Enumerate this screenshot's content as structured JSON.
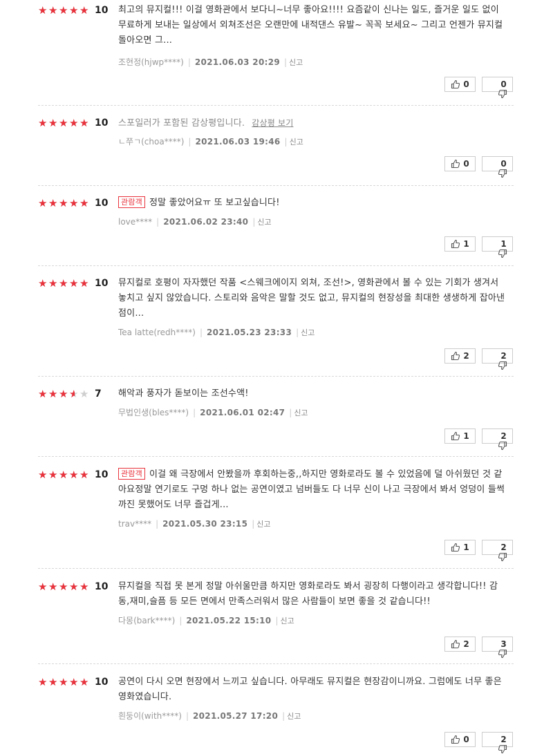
{
  "reviews": [
    {
      "stars": 5,
      "score": "10",
      "badge": "",
      "spoiler": false,
      "text": "최고의 뮤지컬!!! 이걸 영화관에서 보다니~너무 좋아요!!!! 요즘같이 신나는 일도, 즐거운 일도 없이 무료하게 보내는 일상에서 외쳐조선은 오랜만에 내적댄스 유발~ 꼭꼭 보세요~ 그리고 언젠가 뮤지컬 돌아오면 그...",
      "author": "조현정(hjwp****)",
      "date": "2021.06.03 20:29",
      "report": "신고",
      "up": "0",
      "down": "0"
    },
    {
      "stars": 5,
      "score": "10",
      "badge": "",
      "spoiler": true,
      "text": "스포일러가 포함된 감상평입니다.",
      "spoiler_link": "감상평 보기",
      "author": "ㄴ쭈ㄱ(choa****)",
      "date": "2021.06.03 19:46",
      "report": "신고",
      "up": "0",
      "down": "0"
    },
    {
      "stars": 5,
      "score": "10",
      "badge": "관람객",
      "spoiler": false,
      "text": "정말 좋았어요ㅠ 또 보고싶습니다!",
      "author": "love****",
      "date": "2021.06.02 23:40",
      "report": "신고",
      "up": "1",
      "down": "1"
    },
    {
      "stars": 5,
      "score": "10",
      "badge": "",
      "spoiler": false,
      "text": "뮤지컬로 호평이 자자했던 작품 <스웨크에이지 외쳐, 조선!>, 영화관에서 볼 수 있는 기회가 생겨서 놓치고 싶지 않았습니다. 스토리와 음악은 말할 것도 없고, 뮤지컬의 현장성을 최대한 생생하게 잡아낸 점이...",
      "author": "Tea latte(redh****)",
      "date": "2021.05.23 23:33",
      "report": "신고",
      "up": "2",
      "down": "2"
    },
    {
      "stars": 3.5,
      "score": "7",
      "badge": "",
      "spoiler": false,
      "text": "해악과 풍자가 돋보이는 조선수액!",
      "author": "무법인생(bles****)",
      "date": "2021.06.01 02:47",
      "report": "신고",
      "up": "1",
      "down": "2"
    },
    {
      "stars": 5,
      "score": "10",
      "badge": "관람객",
      "spoiler": false,
      "text": "이걸 왜 극장에서 안봤을까 후회하는중,,하지만 영화로라도 볼 수 있었음에 덜 아쉬웠던 것 같아요정말 연기로도 구멍 하나 없는 공연이였고 넘버들도 다 너무 신이 나고 극장에서 봐서 엉덩이 들썩까진 못했어도 너무 즐겁게...",
      "author": "trav****",
      "date": "2021.05.30 23:15",
      "report": "신고",
      "up": "1",
      "down": "2"
    },
    {
      "stars": 5,
      "score": "10",
      "badge": "",
      "spoiler": false,
      "text": "뮤지컬을 직접 못 본게 정말 아쉬울만큼 하지만 영화로라도 봐서 굉장히 다행이라고 생각합니다!! 감동,재미,슬픔 등 모든 면에서 만족스러워서 많은 사람들이 보면 좋을 것 같습니다!!",
      "author": "다몽(bark****)",
      "date": "2021.05.22 15:10",
      "report": "신고",
      "up": "2",
      "down": "3"
    },
    {
      "stars": 5,
      "score": "10",
      "badge": "",
      "spoiler": false,
      "text": "공연이 다시 오면 현장에서 느끼고 싶습니다. 아무래도 뮤지컬은 현장감이니까요. 그럼에도 너무 좋은 영화였습니다.",
      "author": "흰둥이(with****)",
      "date": "2021.05.27 17:20",
      "report": "신고",
      "up": "0",
      "down": "2"
    }
  ],
  "colors": {
    "star": "#e8323c",
    "star_empty": "#cfcfcf",
    "badge": "#e8323c"
  }
}
